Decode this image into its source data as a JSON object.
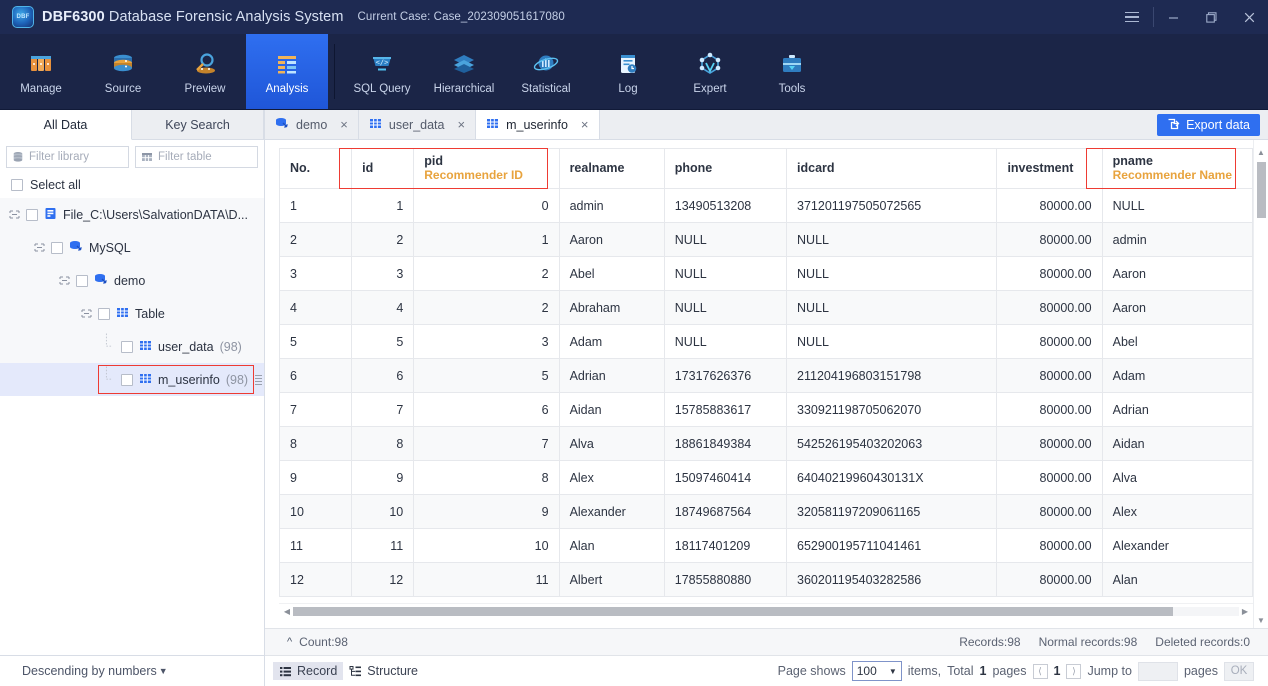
{
  "titlebar": {
    "logo_text": "DBF",
    "app_name": "DBF6300",
    "app_subtitle": "Database Forensic Analysis System",
    "case_label": "Current Case: Case_202309051617080",
    "menu_icon": "hamburger-icon",
    "minimize_icon": "minimize-icon",
    "restore_icon": "restore-icon",
    "close_icon": "close-icon"
  },
  "toolbar": {
    "items": [
      {
        "label": "Manage",
        "icon": "manage-icon",
        "active": false
      },
      {
        "label": "Source",
        "icon": "database-icon",
        "active": false
      },
      {
        "label": "Preview",
        "icon": "magnifier-icon",
        "active": false
      },
      {
        "label": "Analysis",
        "icon": "analysis-grid-icon",
        "active": true
      },
      {
        "label": "SQL Query",
        "icon": "sql-code-icon",
        "active": false
      },
      {
        "label": "Hierarchical",
        "icon": "layers-icon",
        "active": false
      },
      {
        "label": "Statistical",
        "icon": "chart-orbit-icon",
        "active": false
      },
      {
        "label": "Log",
        "icon": "log-clock-icon",
        "active": false
      },
      {
        "label": "Expert",
        "icon": "network-icon",
        "active": false
      },
      {
        "label": "Tools",
        "icon": "toolbox-icon",
        "active": false
      }
    ]
  },
  "sidebar": {
    "tabs": [
      {
        "label": "All Data",
        "active": true
      },
      {
        "label": "Key Search",
        "active": false
      }
    ],
    "filter_library_placeholder": "Filter library",
    "filter_table_placeholder": "Filter table",
    "select_all_label": "Select all",
    "tree": [
      {
        "label": "File_C:\\Users\\SalvationDATA\\D...",
        "count": "",
        "indent": 0,
        "icon": "file-db-icon",
        "expander": "collapse-icon",
        "checkbox": true,
        "selected": false,
        "highlighted": false
      },
      {
        "label": "MySQL",
        "count": "",
        "indent": 1,
        "icon": "mysql-icon",
        "expander": "collapse-icon",
        "checkbox": true,
        "selected": false,
        "highlighted": false
      },
      {
        "label": "demo",
        "count": "",
        "indent": 2,
        "icon": "mysql-icon",
        "expander": "collapse-icon",
        "checkbox": true,
        "selected": false,
        "highlighted": false
      },
      {
        "label": "Table",
        "count": "",
        "indent": 3,
        "icon": "table-icon",
        "expander": "collapse-icon",
        "checkbox": true,
        "selected": false,
        "highlighted": false
      },
      {
        "label": "user_data",
        "count": "(98)",
        "indent": 4,
        "icon": "table-icon",
        "expander": "tree-branch",
        "checkbox": true,
        "selected": false,
        "highlighted": false
      },
      {
        "label": "m_userinfo",
        "count": "(98)",
        "indent": 4,
        "icon": "table-icon",
        "expander": "tree-branch-end",
        "checkbox": true,
        "selected": true,
        "highlighted": true
      }
    ],
    "sort_label": "Descending by numbers",
    "sort_caret": "caret-down-icon"
  },
  "content": {
    "tabs": [
      {
        "label": "demo",
        "icon": "mysql-icon",
        "active": false,
        "close": "close-icon"
      },
      {
        "label": "user_data",
        "icon": "table-icon",
        "active": false,
        "close": "close-icon"
      },
      {
        "label": "m_userinfo",
        "icon": "table-icon",
        "active": true,
        "close": "close-icon"
      }
    ],
    "export_label": "Export data",
    "export_icon": "export-icon"
  },
  "table": {
    "columns": [
      {
        "key": "no",
        "title": "No.",
        "subtitle": "",
        "align": "left",
        "cls": ""
      },
      {
        "key": "id",
        "title": "id",
        "subtitle": "",
        "align": "right",
        "cls": "c-id"
      },
      {
        "key": "pid",
        "title": "pid",
        "subtitle": "Recommender ID",
        "align": "right",
        "cls": "c-pid"
      },
      {
        "key": "realname",
        "title": "realname",
        "subtitle": "",
        "align": "left",
        "cls": ""
      },
      {
        "key": "phone",
        "title": "phone",
        "subtitle": "",
        "align": "left",
        "cls": ""
      },
      {
        "key": "idcard",
        "title": "idcard",
        "subtitle": "",
        "align": "left",
        "cls": ""
      },
      {
        "key": "investment",
        "title": "investment",
        "subtitle": "",
        "align": "right",
        "cls": "c-inv"
      },
      {
        "key": "pname",
        "title": "pname",
        "subtitle": "Recommender Name",
        "align": "left",
        "cls": ""
      }
    ],
    "rows": [
      {
        "no": "1",
        "id": "1",
        "pid": "0",
        "realname": "admin",
        "phone": "13490513208",
        "idcard": "371201197505072565",
        "investment": "80000.00",
        "pname": "NULL"
      },
      {
        "no": "2",
        "id": "2",
        "pid": "1",
        "realname": "Aaron",
        "phone": "NULL",
        "idcard": "NULL",
        "investment": "80000.00",
        "pname": "admin"
      },
      {
        "no": "3",
        "id": "3",
        "pid": "2",
        "realname": "Abel",
        "phone": "NULL",
        "idcard": "NULL",
        "investment": "80000.00",
        "pname": "Aaron"
      },
      {
        "no": "4",
        "id": "4",
        "pid": "2",
        "realname": "Abraham",
        "phone": "NULL",
        "idcard": "NULL",
        "investment": "80000.00",
        "pname": "Aaron"
      },
      {
        "no": "5",
        "id": "5",
        "pid": "3",
        "realname": "Adam",
        "phone": "NULL",
        "idcard": "NULL",
        "investment": "80000.00",
        "pname": "Abel"
      },
      {
        "no": "6",
        "id": "6",
        "pid": "5",
        "realname": "Adrian",
        "phone": "17317626376",
        "idcard": "211204196803151798",
        "investment": "80000.00",
        "pname": "Adam"
      },
      {
        "no": "7",
        "id": "7",
        "pid": "6",
        "realname": "Aidan",
        "phone": "15785883617",
        "idcard": "330921198705062070",
        "investment": "80000.00",
        "pname": "Adrian"
      },
      {
        "no": "8",
        "id": "8",
        "pid": "7",
        "realname": "Alva",
        "phone": "18861849384",
        "idcard": "542526195403202063",
        "investment": "80000.00",
        "pname": "Aidan"
      },
      {
        "no": "9",
        "id": "9",
        "pid": "8",
        "realname": "Alex",
        "phone": "15097460414",
        "idcard": "64040219960430131X",
        "investment": "80000.00",
        "pname": "Alva"
      },
      {
        "no": "10",
        "id": "10",
        "pid": "9",
        "realname": "Alexander",
        "phone": "18749687564",
        "idcard": "320581197209061165",
        "investment": "80000.00",
        "pname": "Alex"
      },
      {
        "no": "11",
        "id": "11",
        "pid": "10",
        "realname": "Alan",
        "phone": "18117401209",
        "idcard": "652900195711041461",
        "investment": "80000.00",
        "pname": "Alexander"
      },
      {
        "no": "12",
        "id": "12",
        "pid": "11",
        "realname": "Albert",
        "phone": "17855880880",
        "idcard": "360201195403282586",
        "investment": "80000.00",
        "pname": "Alan"
      }
    ]
  },
  "status": {
    "collapse_icon": "chevron-up-icon",
    "count_label": "Count:98",
    "records_label": "Records:98",
    "normal_label": "Normal records:98",
    "deleted_label": "Deleted records:0"
  },
  "footer": {
    "record_label": "Record",
    "record_icon": "list-icon",
    "structure_label": "Structure",
    "structure_icon": "structure-icon",
    "page_shows_label": "Page shows",
    "page_size": "100",
    "page_size_caret": "caret-down-icon",
    "items_label": "items,",
    "total_label": "Total",
    "total_pages": "1",
    "pages_label": "pages",
    "prev_icon": "chevron-left-icon",
    "current_page": "1",
    "next_icon": "chevron-right-icon",
    "jump_to_label": "Jump to",
    "jump_value": "",
    "jump_pages_label": "pages",
    "ok_label": "OK"
  },
  "colors": {
    "accent": "#2f6ff0",
    "title_bg": "#1e2a52",
    "toolbar_bg": "#1b2547",
    "highlight_red": "#ee3b33",
    "orange_sub": "#e8a33d",
    "id_tan": "#b08b5e",
    "teal": "#35a39a"
  }
}
